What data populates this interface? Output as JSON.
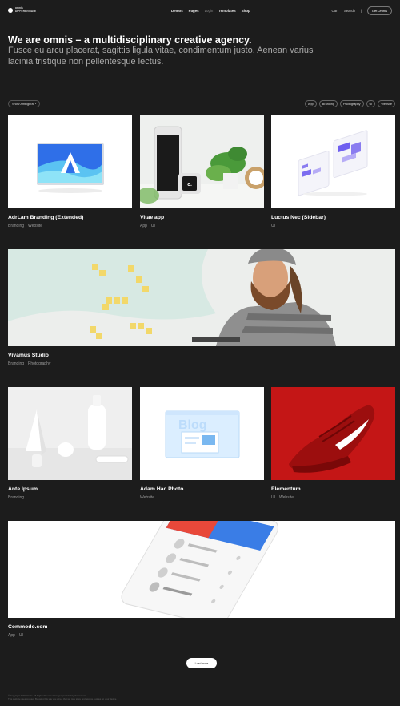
{
  "header": {
    "logo_line1": "omnis",
    "logo_line2": "DIFFERENTIATE",
    "nav": [
      {
        "label": "Demos",
        "dim": false
      },
      {
        "label": "Pages",
        "dim": false
      },
      {
        "label": "Login",
        "dim": true
      },
      {
        "label": "Templates",
        "dim": false
      },
      {
        "label": "Shop",
        "dim": false
      }
    ],
    "cart": "Cart",
    "search": "Search",
    "separator": "|",
    "cta": "Get Omnis"
  },
  "hero": {
    "title": "We are omnis – a multidisciplinary creative agency.",
    "subtitle": "Fusce eu arcu placerat, sagittis ligula vitae, condimentum justo. Aenean varius lacinia tristique non pellentesque lectus."
  },
  "filters": {
    "show_label": "Show Ambigerat ⁵",
    "tags": [
      "App",
      "Branding",
      "Photography",
      "UI",
      "Website"
    ]
  },
  "projects": [
    {
      "title": "AdrLam Branding (Extended)",
      "cats": [
        "Branding",
        "Website"
      ]
    },
    {
      "title": "Vitae app",
      "cats": [
        "App",
        "UI"
      ]
    },
    {
      "title": "Luctus Nec (Sidebar)",
      "cats": [
        "UI"
      ]
    },
    {
      "title": "Vivamus Studio",
      "cats": [
        "Branding",
        "Photography"
      ]
    },
    {
      "title": "Ante Ipsum",
      "cats": [
        "Branding"
      ]
    },
    {
      "title": "Adam Hac Photo",
      "cats": [
        "Website"
      ]
    },
    {
      "title": "Elementum",
      "cats": [
        "UI",
        "Website"
      ]
    },
    {
      "title": "Commodo.com",
      "cats": [
        "App",
        "UI"
      ]
    }
  ],
  "load_more": "Load more",
  "footer": {
    "line1": "© Copyright 2020 Omnis. All Rights Reserved. Images provided by the authors.",
    "line2": "This website uses cookies. By using this site you agree that we may store and access cookies on your device."
  },
  "colors": {
    "background": "#1c1c1c",
    "nike_red": "#c41616",
    "accent_blue": "#3a7de6"
  }
}
